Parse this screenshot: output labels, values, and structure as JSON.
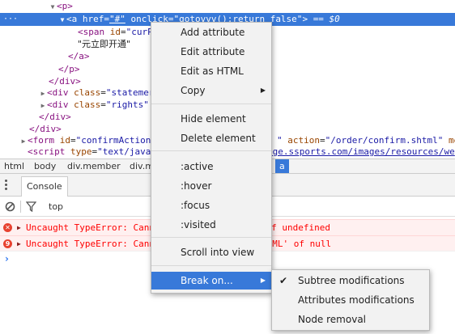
{
  "elements": {
    "rows": [
      {
        "open": "<",
        "tag": "p",
        "close": ">"
      },
      {
        "open": "<",
        "tag": "a",
        "a1": "href",
        "v1": "\"#\"",
        "a2": "onclick",
        "v2": "\"gotovvv();return false\"",
        "close": ">",
        "eq": "== $0"
      },
      {
        "open": "<",
        "tag": "span",
        "a1": "id",
        "v1": "\"curP"
      },
      {
        "text": "\"元立即开通\""
      },
      {
        "open": "</",
        "tag": "a",
        "close": ">"
      },
      {
        "open": "</",
        "tag": "p",
        "close": ">"
      },
      {
        "open": "</",
        "tag": "div",
        "close": ">"
      },
      {
        "open": "<",
        "tag": "div",
        "a1": "class",
        "v1": "\"statemer"
      },
      {
        "open": "<",
        "tag": "div",
        "a1": "class",
        "v1": "\"rights\":"
      },
      {
        "open": "</",
        "tag": "div",
        "close": ">"
      },
      {
        "open": "</",
        "tag": "div",
        "close": ">"
      },
      {
        "open": "<",
        "tag": "form",
        "a1": "id",
        "v1": "\"confirmAction",
        "tail_v": "\"",
        "a2": "action",
        "v2": "\"/order/confirm.shtml\"",
        "a3": "me"
      },
      {
        "open": "<",
        "tag": "script",
        "a1": "type",
        "v1": "\"text/javal",
        "tail": "age.ssports.com/images/resources/we"
      }
    ]
  },
  "breadcrumb": [
    "html",
    "body",
    "div.member",
    "div.m",
    "a"
  ],
  "console": {
    "tab_label": "Console",
    "context": "top",
    "errors": [
      {
        "badge": "✕",
        "start": "Uncaught TypeError: Cann",
        "end": "te' of undefined"
      },
      {
        "badge": "9",
        "start": "Uncaught TypeError: Cann",
        "end": "HTML' of null"
      }
    ],
    "prompt": "›"
  },
  "context_menu": {
    "items": [
      {
        "label": "Add attribute"
      },
      {
        "label": "Edit attribute"
      },
      {
        "label": "Edit as HTML"
      },
      {
        "label": "Copy",
        "submenu": "▶"
      },
      {
        "label": "Hide element"
      },
      {
        "label": "Delete element"
      },
      {
        "label": ":active"
      },
      {
        "label": ":hover"
      },
      {
        "label": ":focus"
      },
      {
        "label": ":visited"
      },
      {
        "label": "Scroll into view"
      },
      {
        "label": "Break on...",
        "submenu": "▶"
      }
    ]
  },
  "break_on_menu": {
    "items": [
      {
        "label": "Subtree modifications",
        "checked": "✔"
      },
      {
        "label": "Attributes modifications"
      },
      {
        "label": "Node removal"
      }
    ]
  },
  "colors": {
    "selection": "#3879d9",
    "error_text": "#ff0000",
    "error_bg": "#fff0f0"
  }
}
